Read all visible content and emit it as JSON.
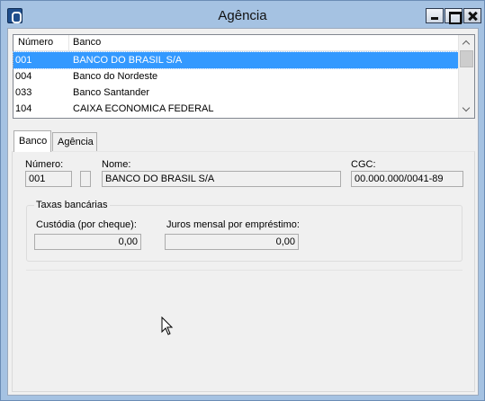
{
  "window": {
    "title": "Agência"
  },
  "list": {
    "columns": [
      "Número",
      "Banco"
    ],
    "rows": [
      {
        "numero": "001",
        "banco": "BANCO DO BRASIL S/A",
        "selected": true
      },
      {
        "numero": "004",
        "banco": "Banco do Nordeste",
        "selected": false
      },
      {
        "numero": "033",
        "banco": "Banco Santander",
        "selected": false
      },
      {
        "numero": "104",
        "banco": "CAIXA ECONOMICA FEDERAL",
        "selected": false
      }
    ]
  },
  "tabs": [
    {
      "label": "Banco",
      "active": true
    },
    {
      "label": "Agência",
      "active": false
    }
  ],
  "form": {
    "numero_label": "Número:",
    "numero_value": "001",
    "nome_label": "Nome:",
    "nome_value": "BANCO DO BRASIL S/A",
    "cgc_label": "CGC:",
    "cgc_value": "00.000.000/0041-89",
    "taxas_legend": "Taxas bancárias",
    "custodia_label": "Custódia (por cheque):",
    "custodia_value": "0,00",
    "juros_label": "Juros mensal por empréstimo:",
    "juros_value": "0,00"
  },
  "icons": {
    "app": "bank-app-icon",
    "minimize": "minimize-icon",
    "maximize": "maximize-icon",
    "close": "close-icon"
  }
}
